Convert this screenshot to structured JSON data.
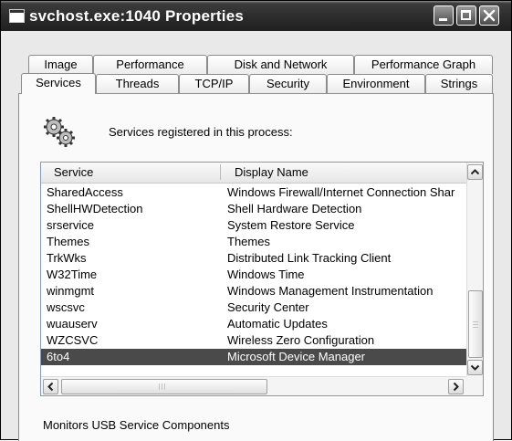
{
  "window": {
    "title": "svchost.exe:1040 Properties"
  },
  "tabs_row1": [
    {
      "label": "Image"
    },
    {
      "label": "Performance"
    },
    {
      "label": "Disk and Network"
    },
    {
      "label": "Performance Graph"
    }
  ],
  "tabs_row2": [
    {
      "label": "Services",
      "active": true
    },
    {
      "label": "Threads"
    },
    {
      "label": "TCP/IP"
    },
    {
      "label": "Security"
    },
    {
      "label": "Environment"
    },
    {
      "label": "Strings"
    }
  ],
  "services_panel": {
    "icon": "gears-icon",
    "heading": "Services registered in this process:",
    "columns": [
      "Service",
      "Display Name"
    ],
    "rows": [
      {
        "service": "SharedAccess",
        "display": "Windows Firewall/Internet Connection Shar"
      },
      {
        "service": "ShellHWDetection",
        "display": "Shell Hardware Detection"
      },
      {
        "service": "srservice",
        "display": "System Restore Service"
      },
      {
        "service": "Themes",
        "display": "Themes"
      },
      {
        "service": "TrkWks",
        "display": "Distributed Link Tracking Client"
      },
      {
        "service": "W32Time",
        "display": "Windows Time"
      },
      {
        "service": "winmgmt",
        "display": "Windows Management Instrumentation"
      },
      {
        "service": "wscsvc",
        "display": "Security Center"
      },
      {
        "service": "wuauserv",
        "display": "Automatic Updates"
      },
      {
        "service": "WZCSVC",
        "display": "Wireless Zero Configuration"
      },
      {
        "service": "6to4",
        "display": "Microsoft Device Manager",
        "selected": true
      }
    ],
    "description": "Monitors USB Service Components"
  },
  "colors": {
    "selection": "#4a4a4a",
    "titlebar": "#2a2a2a"
  }
}
